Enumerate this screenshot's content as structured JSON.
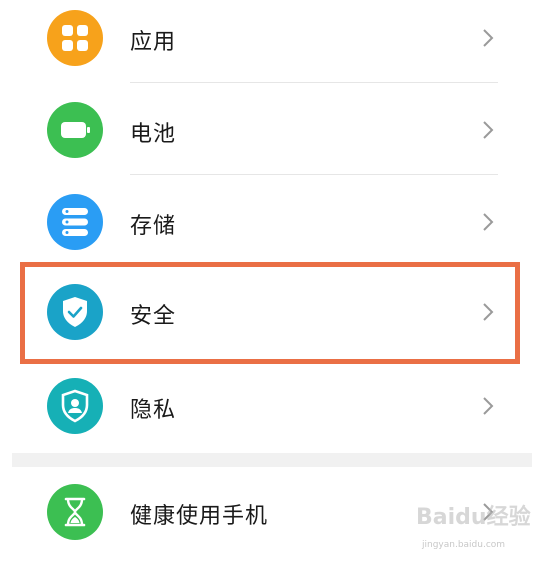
{
  "settings": {
    "items": [
      {
        "label": "应用",
        "icon": "apps-icon",
        "color": "#f7a21b"
      },
      {
        "label": "电池",
        "icon": "battery-icon",
        "color": "#3cbf52"
      },
      {
        "label": "存储",
        "icon": "storage-icon",
        "color": "#2a9df4"
      },
      {
        "label": "安全",
        "icon": "shield-check-icon",
        "color": "#1aa3c8"
      },
      {
        "label": "隐私",
        "icon": "privacy-shield-icon",
        "color": "#16b0b6"
      },
      {
        "label": "健康使用手机",
        "icon": "hourglass-icon",
        "color": "#3cbf52"
      }
    ],
    "highlight_color": "#ea6f45"
  },
  "watermark": {
    "brand": "Baidu经验",
    "url": "jingyan.baidu.com"
  }
}
